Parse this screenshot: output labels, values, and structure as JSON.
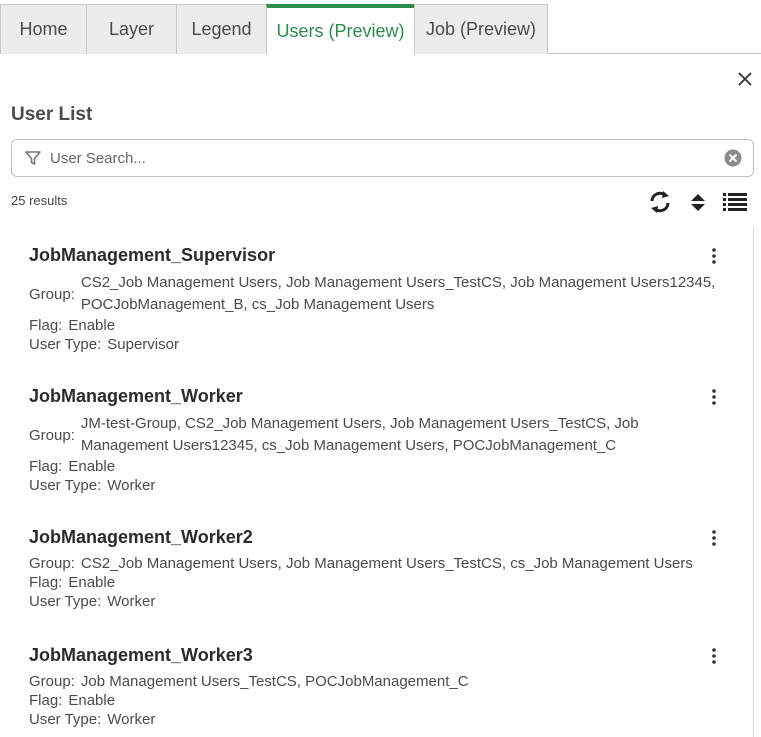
{
  "tabs": [
    {
      "label": "Home"
    },
    {
      "label": "Layer"
    },
    {
      "label": "Legend"
    },
    {
      "label": "Users (Preview)",
      "active": true
    },
    {
      "label": "Job (Preview)"
    }
  ],
  "panel": {
    "title": "User List",
    "search_placeholder": "User Search...",
    "results": "25 results"
  },
  "labels": {
    "group": "Group:",
    "flag": "Flag:",
    "user_type": "User Type:"
  },
  "users": [
    {
      "name": "JobManagement_Supervisor",
      "group": "CS2_Job Management Users, Job Management Users_TestCS, Job Management Users12345, POCJobManagement_B, cs_Job Management Users",
      "flag": "Enable",
      "user_type": "Supervisor"
    },
    {
      "name": "JobManagement_Worker",
      "group": "JM-test-Group, CS2_Job Management Users, Job Management Users_TestCS, Job Management Users12345, cs_Job Management Users, POCJobManagement_C",
      "flag": "Enable",
      "user_type": "Worker"
    },
    {
      "name": "JobManagement_Worker2",
      "group": "CS2_Job Management Users, Job Management Users_TestCS, cs_Job Management Users",
      "flag": "Enable",
      "user_type": "Worker"
    },
    {
      "name": "JobManagement_Worker3",
      "group": "Job Management Users_TestCS, POCJobManagement_C",
      "flag": "Enable",
      "user_type": "Worker"
    }
  ],
  "colors": {
    "accent": "#2e8b4e",
    "tab_inactive": "#ececec"
  }
}
